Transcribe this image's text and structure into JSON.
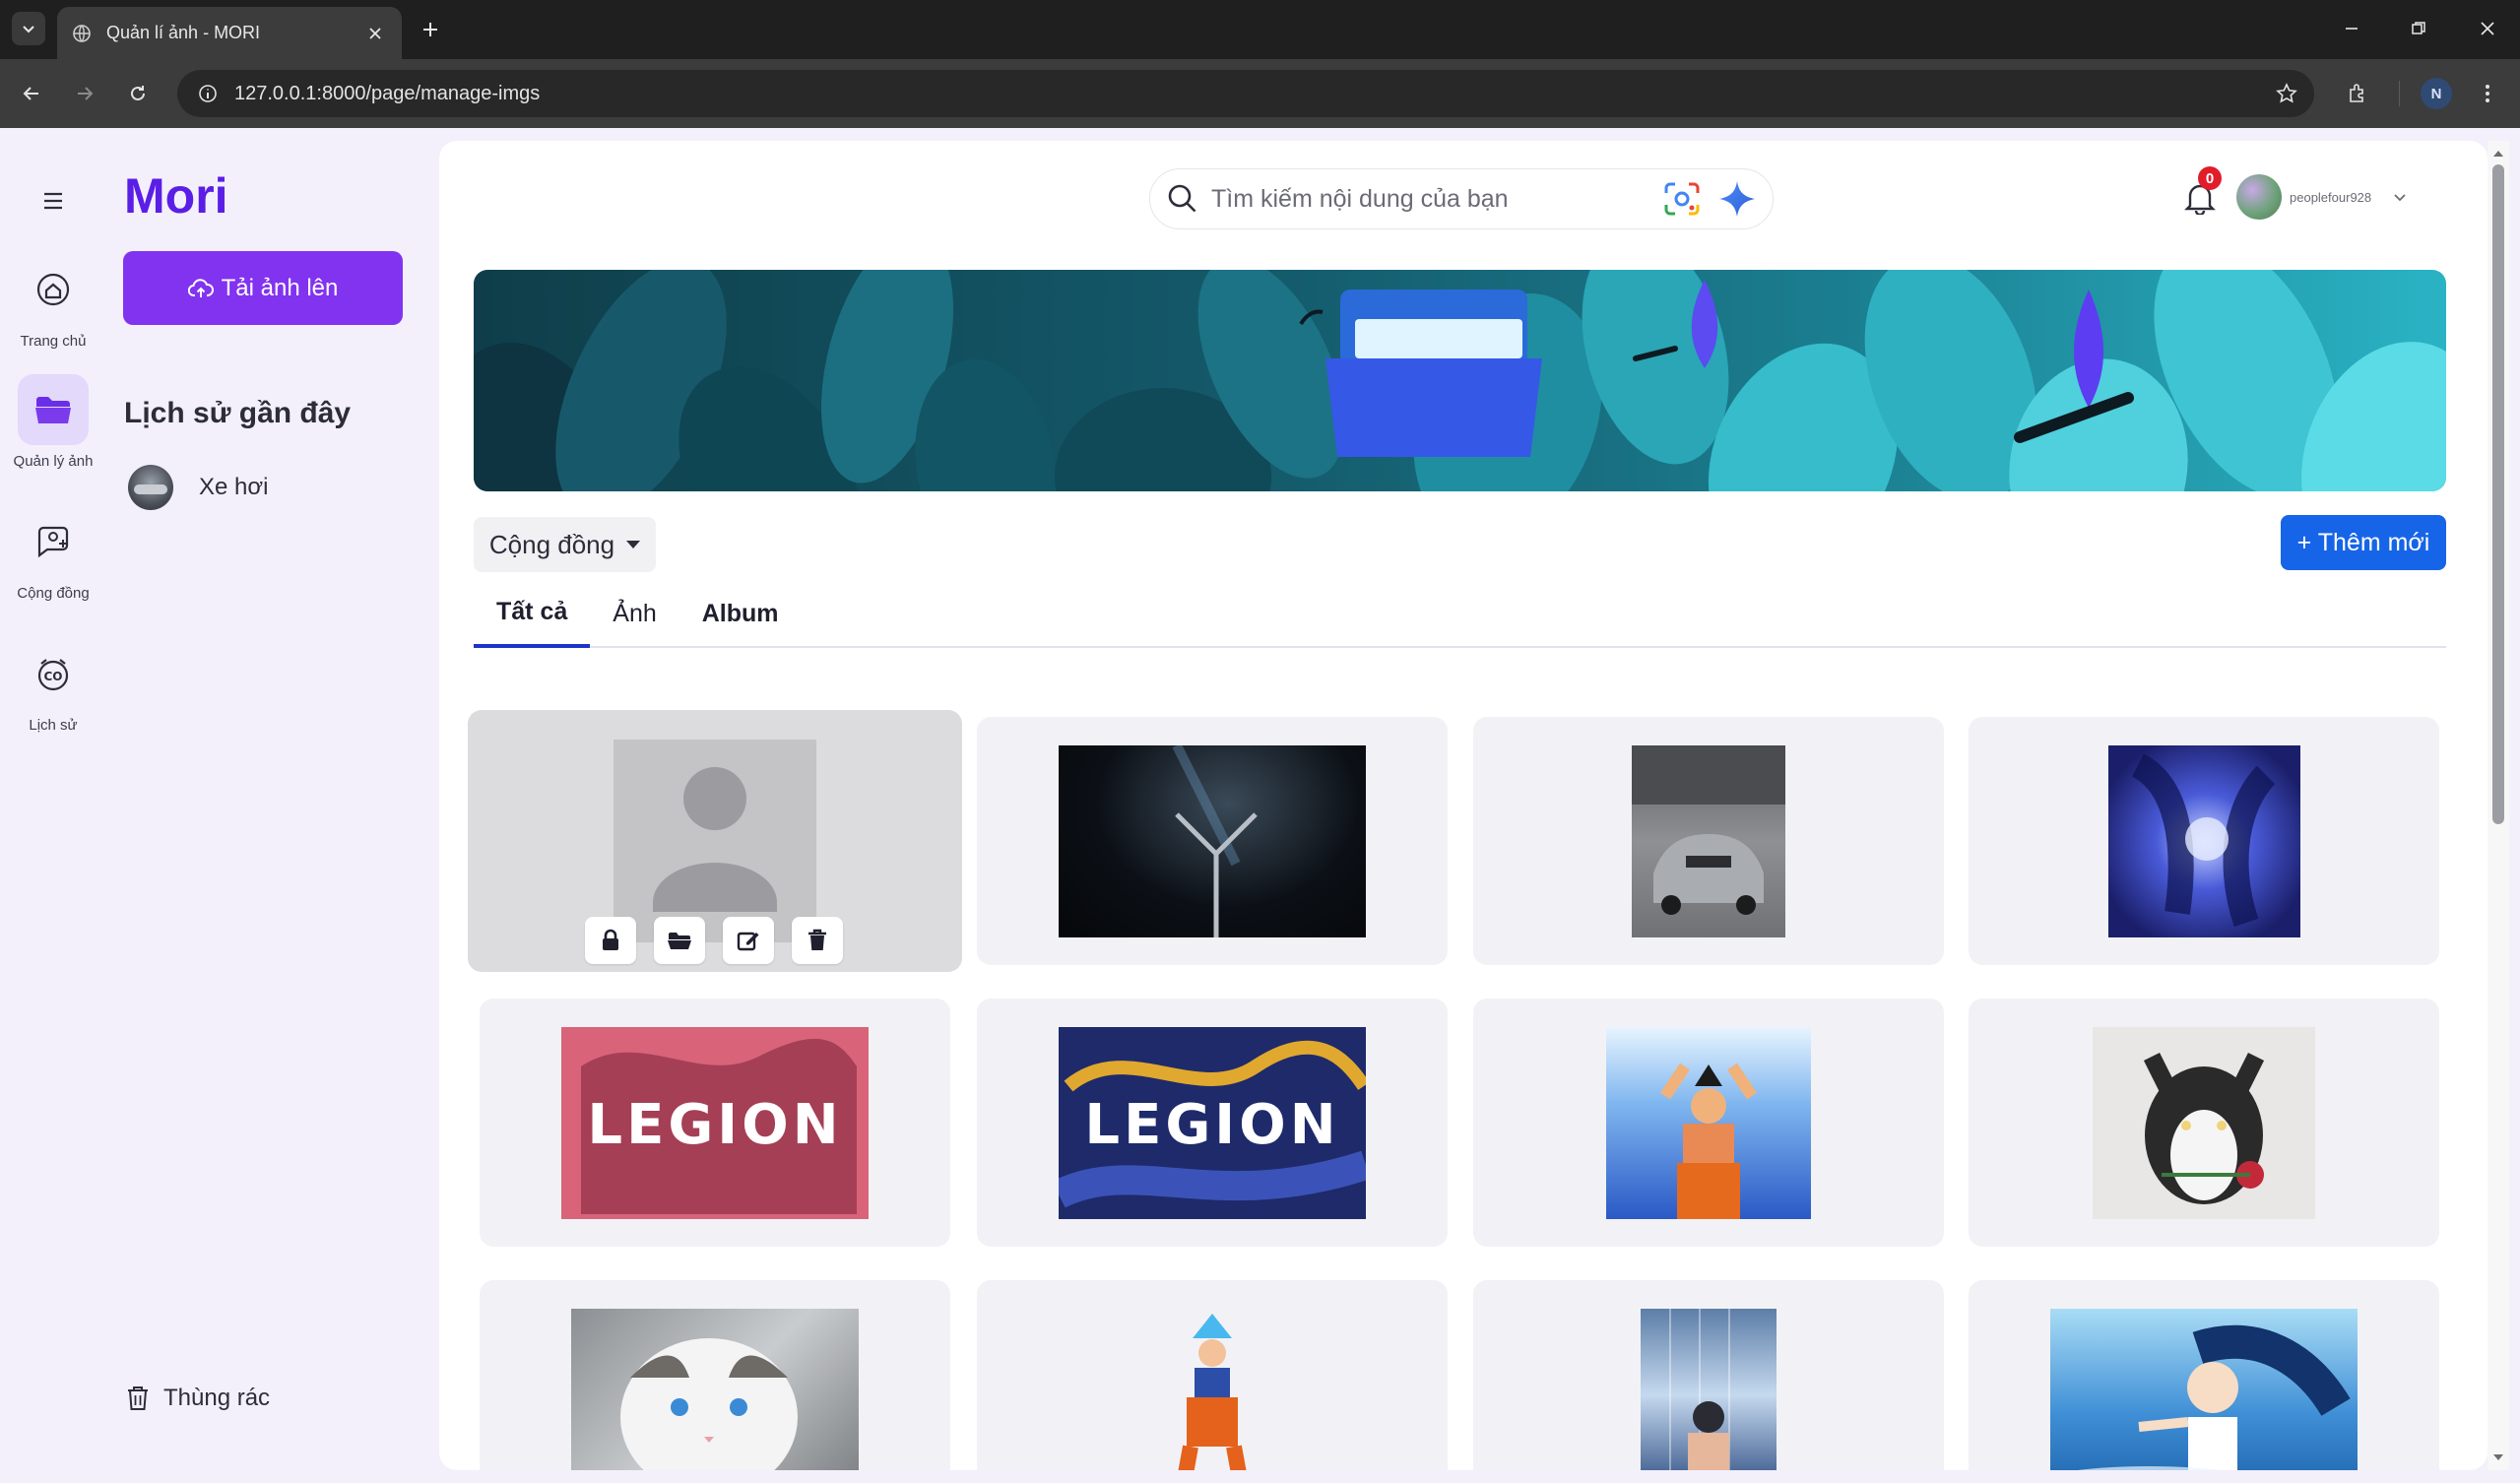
{
  "browser": {
    "tab_title": "Quản lí ảnh - MORI",
    "url": "127.0.0.1:8000/page/manage-imgs",
    "profile_initial": "N"
  },
  "rail": {
    "items": [
      {
        "label": "Trang chủ",
        "icon": "home-icon"
      },
      {
        "label": "Quản lý ảnh",
        "icon": "folder-open-icon",
        "active": true
      },
      {
        "label": "Cộng đồng",
        "icon": "community-icon"
      },
      {
        "label": "Lịch sử",
        "icon": "history-icon"
      }
    ]
  },
  "panel": {
    "brand": "Mori",
    "upload_label": "Tải ảnh lên",
    "recent_title": "Lịch sử gần đây",
    "recent_items": [
      {
        "label": "Xe hơi"
      }
    ],
    "trash_label": "Thùng rác"
  },
  "header": {
    "search_placeholder": "Tìm kiếm nội dung của bạn",
    "notification_count": "0",
    "username": "peoplefour928"
  },
  "toolbar": {
    "scope_label": "Cộng đồng",
    "add_label": "+ Thêm mới"
  },
  "tabs": [
    {
      "label": "Tất cả",
      "active": true
    },
    {
      "label": "Ảnh"
    },
    {
      "label": "Album"
    }
  ],
  "colors": {
    "brand": "#5b1ee6",
    "upload_button": "#8233f0",
    "add_button": "#1665e8",
    "active_tab_underline": "#1d35c7",
    "badge": "#e11d2b"
  },
  "gallery": [
    {
      "subject": "placeholder-avatar",
      "selected": true
    },
    {
      "subject": "dark-laptop"
    },
    {
      "subject": "grey-car"
    },
    {
      "subject": "anime-couple-blue"
    },
    {
      "subject": "legion-pink-dragon"
    },
    {
      "subject": "legion-gold-dragon"
    },
    {
      "subject": "goku-powerup"
    },
    {
      "subject": "husky-with-rose"
    },
    {
      "subject": "ragdoll-cat"
    },
    {
      "subject": "goku-blue-hair"
    },
    {
      "subject": "anime-swimmer-poster"
    },
    {
      "subject": "anime-girl-water"
    }
  ]
}
